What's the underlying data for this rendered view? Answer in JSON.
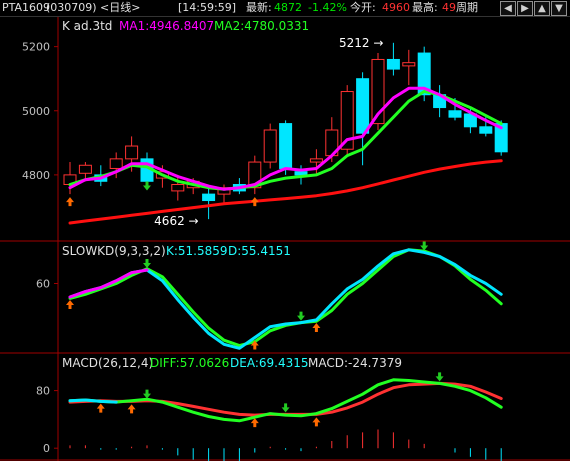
{
  "header": {
    "symbol": "PTA1609",
    "code": "(030709)",
    "period": "<日线>",
    "time": "[14:59:59]",
    "latest_label": "最新:",
    "latest_value": "4872",
    "change_pct": "-1.42%",
    "open_label": "今开:",
    "open_value": "4960",
    "high_label": "最高:",
    "high_value": "49",
    "cycle_label": "周期",
    "nav_icons": [
      "arrow-left-icon",
      "arrow-right-icon",
      "arrow-up-icon",
      "arrow-down-icon"
    ]
  },
  "colors": {
    "up": "#ff3232",
    "down": "#00e6ff",
    "ma1": "#ff00ff",
    "ma2": "#22ff22",
    "red_line": "#ff1010",
    "axis": "#a00000",
    "text": "#c0c0c0"
  },
  "chart_data": [
    {
      "type": "candlestick",
      "title": "K  ad.3td",
      "legend": [
        "MA1:4946.8407",
        "MA2:4780.0331"
      ],
      "y_ticks": [
        4800,
        5000,
        5200
      ],
      "ylim": [
        4600,
        5280
      ],
      "candles": [
        {
          "o": 4770,
          "h": 4840,
          "l": 4740,
          "c": 4800
        },
        {
          "o": 4805,
          "h": 4840,
          "l": 4780,
          "c": 4830
        },
        {
          "o": 4800,
          "h": 4830,
          "l": 4765,
          "c": 4780
        },
        {
          "o": 4820,
          "h": 4870,
          "l": 4790,
          "c": 4850
        },
        {
          "o": 4850,
          "h": 4920,
          "l": 4810,
          "c": 4890
        },
        {
          "o": 4850,
          "h": 4870,
          "l": 4770,
          "c": 4780
        },
        {
          "o": 4790,
          "h": 4830,
          "l": 4760,
          "c": 4810
        },
        {
          "o": 4750,
          "h": 4800,
          "l": 4720,
          "c": 4770
        },
        {
          "o": 4760,
          "h": 4790,
          "l": 4740,
          "c": 4780
        },
        {
          "o": 4740,
          "h": 4760,
          "l": 4662,
          "c": 4720
        },
        {
          "o": 4740,
          "h": 4770,
          "l": 4710,
          "c": 4760
        },
        {
          "o": 4770,
          "h": 4790,
          "l": 4740,
          "c": 4750
        },
        {
          "o": 4760,
          "h": 4860,
          "l": 4740,
          "c": 4840
        },
        {
          "o": 4840,
          "h": 4960,
          "l": 4820,
          "c": 4940
        },
        {
          "o": 4960,
          "h": 4970,
          "l": 4800,
          "c": 4820
        },
        {
          "o": 4810,
          "h": 4830,
          "l": 4770,
          "c": 4800
        },
        {
          "o": 4840,
          "h": 4880,
          "l": 4800,
          "c": 4850
        },
        {
          "o": 4860,
          "h": 4980,
          "l": 4840,
          "c": 4940
        },
        {
          "o": 4880,
          "h": 5080,
          "l": 4860,
          "c": 5060
        },
        {
          "o": 5100,
          "h": 5120,
          "l": 4830,
          "c": 4930
        },
        {
          "o": 4960,
          "h": 5180,
          "l": 4940,
          "c": 5160
        },
        {
          "o": 5160,
          "h": 5212,
          "l": 5110,
          "c": 5130
        },
        {
          "o": 5140,
          "h": 5190,
          "l": 5080,
          "c": 5150
        },
        {
          "o": 5180,
          "h": 5200,
          "l": 5030,
          "c": 5050
        },
        {
          "o": 5050,
          "h": 5080,
          "l": 4980,
          "c": 5010
        },
        {
          "o": 5000,
          "h": 5040,
          "l": 4970,
          "c": 4980
        },
        {
          "o": 4990,
          "h": 5010,
          "l": 4930,
          "c": 4950
        },
        {
          "o": 4950,
          "h": 4980,
          "l": 4920,
          "c": 4930
        },
        {
          "o": 4960,
          "h": 4970,
          "l": 4860,
          "c": 4872
        }
      ],
      "ma1": [
        4760,
        4785,
        4790,
        4810,
        4835,
        4835,
        4815,
        4795,
        4780,
        4765,
        4755,
        4760,
        4770,
        4800,
        4820,
        4815,
        4820,
        4860,
        4910,
        4920,
        4990,
        5040,
        5070,
        5070,
        5050,
        5020,
        4995,
        4970,
        4947
      ],
      "ma2": [
        4770,
        4785,
        4795,
        4810,
        4830,
        4825,
        4800,
        4780,
        4770,
        4760,
        4755,
        4760,
        4765,
        4780,
        4790,
        4795,
        4800,
        4820,
        4860,
        4880,
        4930,
        4980,
        5030,
        5060,
        5050,
        5030,
        5010,
        4985,
        4960
      ],
      "long_ma": [
        4650,
        4656,
        4662,
        4668,
        4674,
        4680,
        4686,
        4692,
        4698,
        4704,
        4710,
        4714,
        4718,
        4722,
        4726,
        4730,
        4735,
        4742,
        4750,
        4760,
        4772,
        4784,
        4796,
        4808,
        4818,
        4826,
        4834,
        4840,
        4844
      ],
      "annotations": [
        {
          "text": "5212",
          "index": 21,
          "value": 5212
        },
        {
          "text": "4662",
          "index": 9,
          "value": 4662
        }
      ],
      "up_arrows": [
        0,
        12
      ],
      "down_arrows": [
        5
      ],
      "ylabel": "",
      "xlabel": ""
    },
    {
      "type": "line",
      "title": "SLOWKD(9,3,3,2)",
      "legend": [
        "K:51.5859",
        "D:55.4151"
      ],
      "y_ticks": [
        60
      ],
      "ylim": [
        10,
        90
      ],
      "k": [
        50,
        54,
        57,
        62,
        68,
        70,
        62,
        48,
        35,
        23,
        15,
        12,
        20,
        28,
        30,
        31,
        33,
        45,
        56,
        63,
        73,
        82,
        85,
        83,
        80,
        74,
        66,
        60,
        52
      ],
      "d": [
        49,
        52,
        56,
        60,
        66,
        71,
        65,
        52,
        39,
        27,
        18,
        14,
        17,
        25,
        29,
        31,
        32,
        40,
        52,
        60,
        70,
        80,
        85,
        84,
        80,
        73,
        63,
        55,
        45
      ],
      "up_arrows": [
        0,
        12,
        16
      ],
      "down_arrows": [
        5,
        15,
        23
      ]
    },
    {
      "type": "line",
      "title": "MACD(26,12,4)",
      "legend": [
        "DIFF:57.0626",
        "DEA:69.4315",
        "MACD:-24.7379"
      ],
      "y_ticks": [
        80,
        0
      ],
      "ylim": [
        -15,
        110
      ],
      "diff": [
        66,
        67,
        65,
        64,
        66,
        68,
        64,
        57,
        50,
        44,
        40,
        38,
        43,
        48,
        46,
        45,
        48,
        55,
        65,
        75,
        88,
        95,
        94,
        92,
        90,
        86,
        80,
        70,
        57
      ],
      "dea": [
        64,
        65,
        66,
        65,
        65,
        66,
        65,
        62,
        58,
        54,
        50,
        47,
        46,
        47,
        47,
        47,
        47,
        50,
        56,
        64,
        75,
        84,
        88,
        89,
        90,
        89,
        86,
        78,
        69
      ],
      "macd": [
        4,
        4,
        -2,
        -2,
        2,
        4,
        -2,
        -10,
        -16,
        -20,
        -20,
        -18,
        -6,
        2,
        -2,
        -4,
        2,
        10,
        18,
        22,
        26,
        22,
        12,
        6,
        0,
        -6,
        -12,
        -16,
        -25
      ],
      "up_arrows": [
        2,
        4,
        12,
        16
      ],
      "down_arrows": [
        5,
        14,
        24
      ]
    }
  ]
}
